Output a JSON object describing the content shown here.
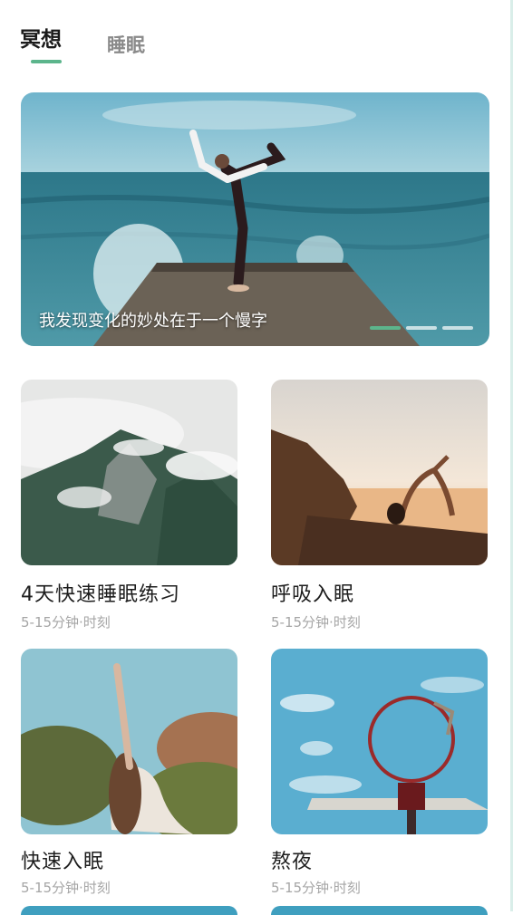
{
  "tabs": [
    {
      "label": "冥想",
      "active": true
    },
    {
      "label": "睡眠",
      "active": false
    }
  ],
  "accent_color": "#5cb58c",
  "banner": {
    "caption": "我发现变化的妙处在于一个慢字",
    "slide_count": 3,
    "active_slide": 1
  },
  "courses": [
    {
      "title": "4天快速睡眠练习",
      "meta": "5-15分钟·时刻"
    },
    {
      "title": "呼吸入眠",
      "meta": "5-15分钟·时刻"
    },
    {
      "title": "快速入眠",
      "meta": "5-15分钟·时刻"
    },
    {
      "title": "熬夜",
      "meta": "5-15分钟·时刻"
    }
  ]
}
